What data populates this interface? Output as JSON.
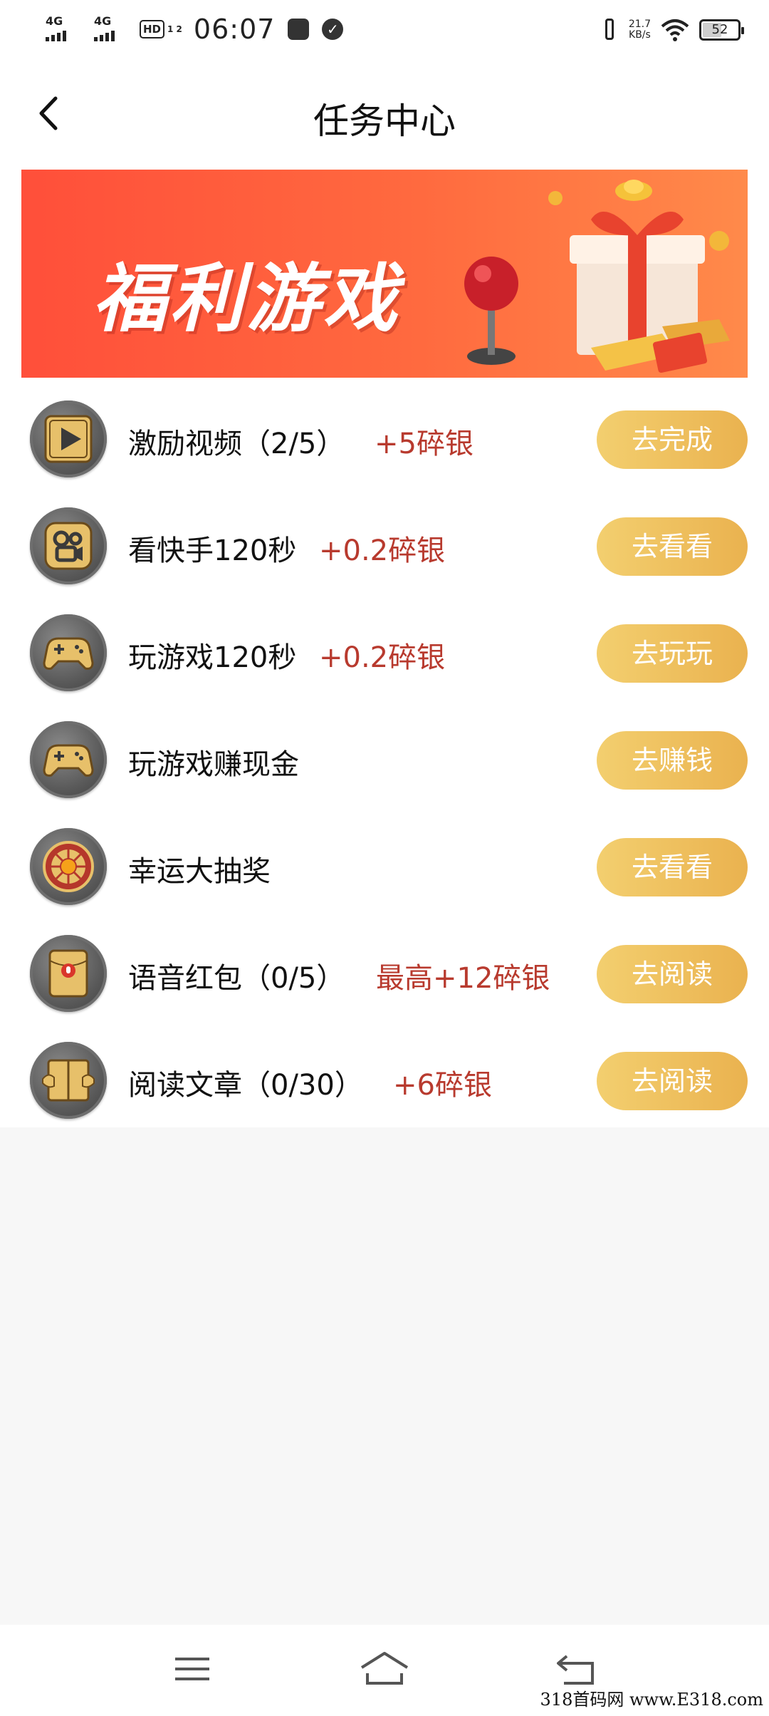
{
  "status_bar": {
    "signal1": "4G",
    "signal2": "4G",
    "hd_label": "HD",
    "hd_sub": "1 2",
    "time": "06:07",
    "speed_value": "21.7",
    "speed_unit": "KB/s",
    "battery": "52"
  },
  "header": {
    "title": "任务中心",
    "back_icon": "chevron-left-icon"
  },
  "banner": {
    "title": "福利游戏",
    "colors": {
      "start": "#ff4f3a",
      "end": "#ff8a4a"
    }
  },
  "tasks": [
    {
      "icon": "play-video-icon",
      "name": "激励视频（2/5）",
      "reward": "+5碎银",
      "button": "去完成"
    },
    {
      "icon": "kuaishou-icon",
      "name": "看快手120秒",
      "reward": "+0.2碎银",
      "button": "去看看"
    },
    {
      "icon": "gamepad-icon",
      "name": "玩游戏120秒",
      "reward": "+0.2碎银",
      "button": "去玩玩"
    },
    {
      "icon": "gamepad-icon",
      "name": "玩游戏赚现金",
      "reward": "",
      "button": "去赚钱"
    },
    {
      "icon": "lucky-wheel-icon",
      "name": "幸运大抽奖",
      "reward": "",
      "button": "去看看"
    },
    {
      "icon": "voice-redpacket-icon",
      "name": "语音红包（0/5）",
      "reward": "最高+12碎银",
      "button": "去阅读"
    },
    {
      "icon": "book-icon",
      "name": "阅读文章（0/30）",
      "reward": "+6碎银",
      "button": "去阅读"
    }
  ],
  "theme": {
    "reward_color": "#b83a2e",
    "button_gradient_start": "#f3cf6f",
    "button_gradient_end": "#eab24f"
  },
  "navbar": {
    "menu_icon": "menu-icon",
    "home_icon": "home-icon",
    "back_icon": "back-arrow-icon"
  },
  "watermark": "318首码网 www.E318.com"
}
